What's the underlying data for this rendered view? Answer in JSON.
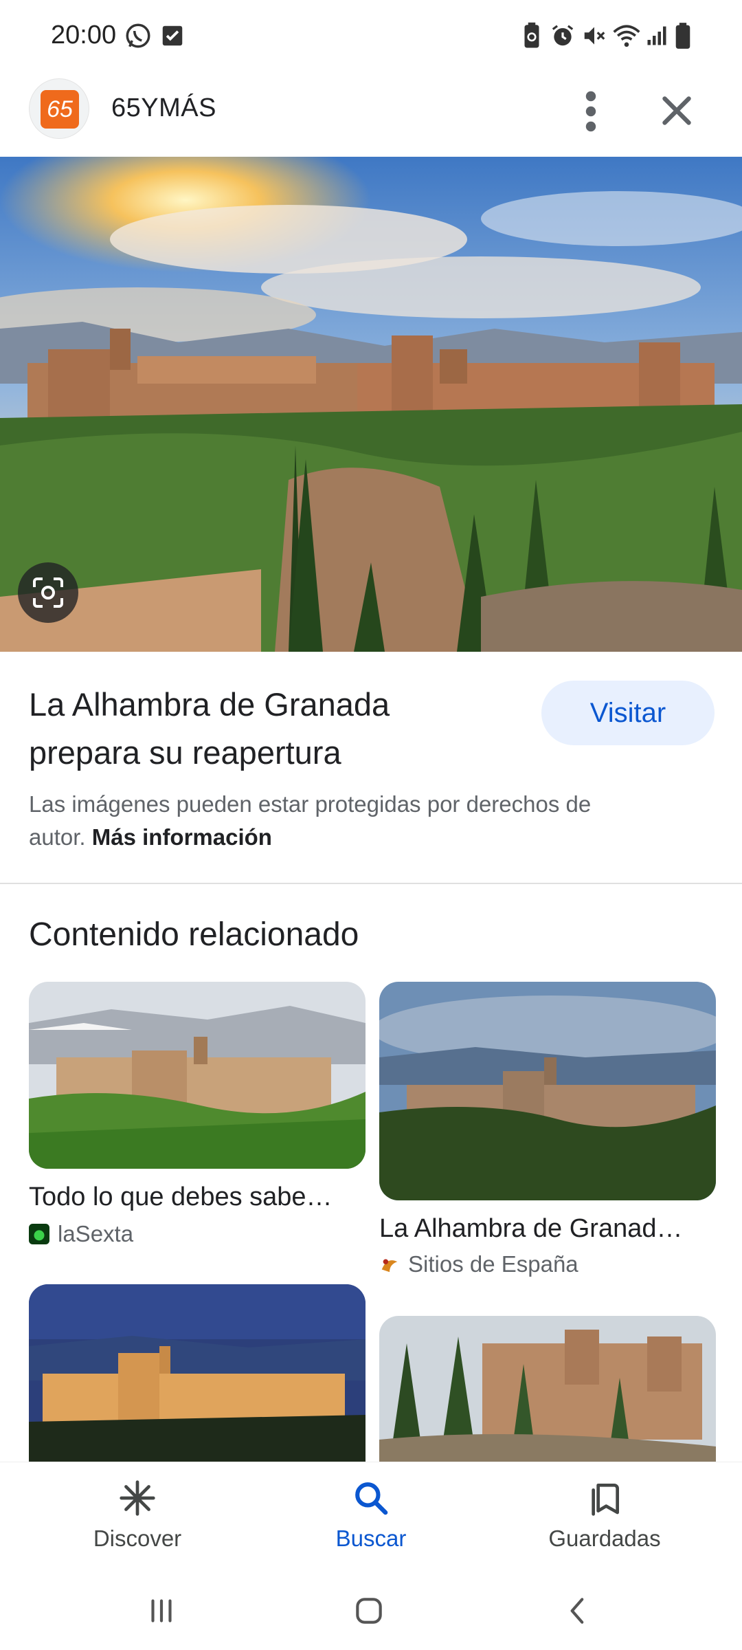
{
  "status_bar": {
    "time": "20:00",
    "left_icons": [
      "whatsapp-icon",
      "checkbox-notification-icon"
    ],
    "right_icons": [
      "battery-saver-icon",
      "alarm-icon",
      "mute-icon",
      "wifi-icon",
      "signal-icon",
      "battery-icon"
    ]
  },
  "header": {
    "logo_text": "65",
    "site_name": "65YMÁS",
    "menu_icon": "more-vert-icon",
    "close_icon": "close-icon"
  },
  "result": {
    "title": "La Alhambra de Granada prepara su reapertura",
    "visit_label": "Visitar",
    "copyright_text": "Las imágenes pueden estar protegidas por derechos de autor.",
    "more_info_label": "Más información"
  },
  "related": {
    "heading": "Contenido relacionado",
    "items": [
      {
        "title": "Todo lo que debes sabe…",
        "source": "laSexta"
      },
      {
        "title": "La Alhambra de Granad…",
        "source": "Sitios de España"
      },
      {
        "title": "",
        "source": ""
      },
      {
        "title": "",
        "source": ""
      }
    ]
  },
  "bottom_nav": [
    {
      "label": "Discover",
      "icon": "discover-asterisk-icon",
      "active": false
    },
    {
      "label": "Buscar",
      "icon": "search-icon",
      "active": true
    },
    {
      "label": "Guardadas",
      "icon": "bookmarks-icon",
      "active": false
    }
  ],
  "colors": {
    "accent": "#0b57d0",
    "visit_bg": "#e8f0fe",
    "logo_orange": "#ef6a1c",
    "text_primary": "#202124",
    "text_secondary": "#5f6368"
  }
}
